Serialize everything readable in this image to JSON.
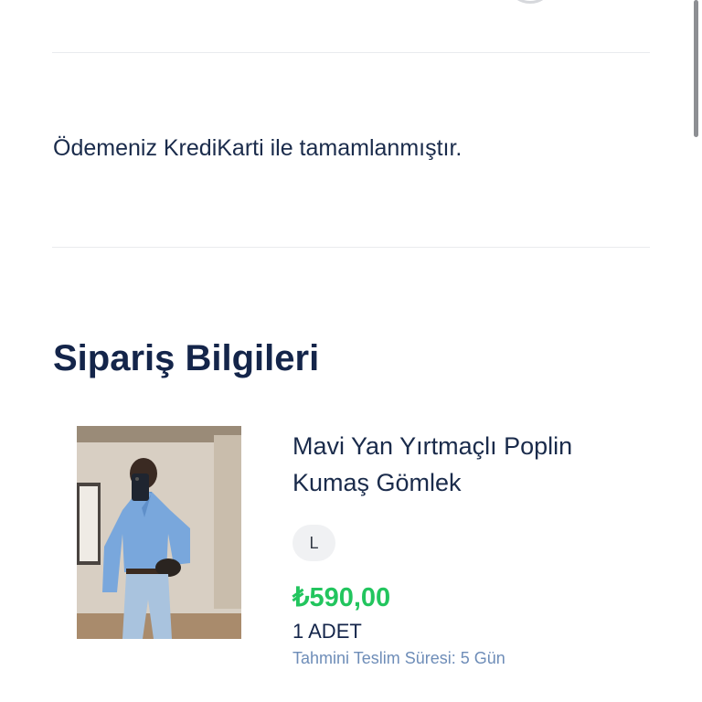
{
  "payment": {
    "message": "Ödemeniz KrediKarti ile tamamlanmıştır."
  },
  "order": {
    "section_title": "Sipariş Bilgileri",
    "items": [
      {
        "name": "Mavi Yan Yırtmaçlı Poplin Kumaş Gömlek",
        "size": "L",
        "price": "₺590,00",
        "quantity": "1 ADET",
        "delivery_estimate": "Tahmini Teslim Süresi: 5 Gün"
      }
    ]
  },
  "colors": {
    "price": "#22c55e",
    "title": "#14254a",
    "delivery_text": "#6e8db8",
    "size_chip_bg": "#f0f1f3"
  },
  "icons": {
    "top_partial": "circle-icon"
  }
}
